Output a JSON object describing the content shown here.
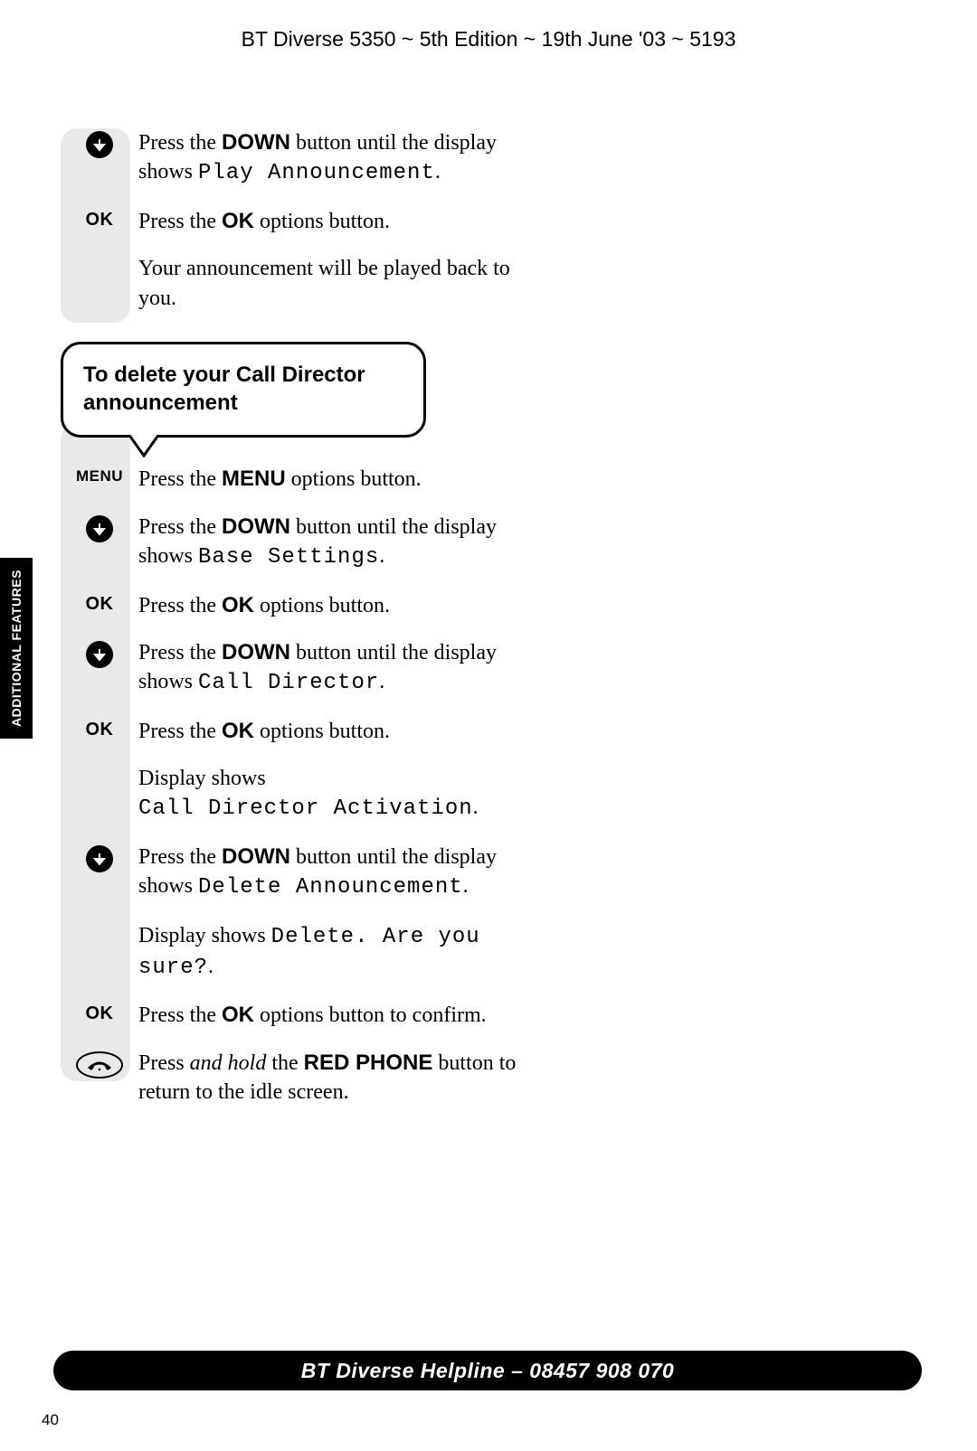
{
  "header": "BT Diverse 5350 ~ 5th Edition ~ 19th June '03 ~ 5193",
  "side_tab": "ADDITIONAL FEATURES",
  "section1": {
    "steps": [
      {
        "key_type": "down",
        "text_pre": "Press the ",
        "bold1": "DOWN",
        "text_mid": " button until the display shows ",
        "lcd1": "Play Announcement",
        "text_post": "."
      },
      {
        "key_type": "ok",
        "key_label": "OK",
        "text_pre": "Press the ",
        "bold1": "OK",
        "text_post": " options button."
      },
      {
        "key_type": "blank",
        "text_plain": "Your announcement will be played back to you."
      }
    ]
  },
  "callout": "To delete your Call Director announcement",
  "section2": {
    "steps": [
      {
        "key_type": "menu",
        "key_label": "MENU",
        "text_pre": "Press the ",
        "bold1": "MENU",
        "text_post": " options button."
      },
      {
        "key_type": "down",
        "text_pre": "Press the ",
        "bold1": "DOWN",
        "text_mid": " button until the display shows ",
        "lcd1": "Base Settings",
        "text_post": "."
      },
      {
        "key_type": "ok",
        "key_label": "OK",
        "text_pre": "Press the ",
        "bold1": "OK",
        "text_post": " options button."
      },
      {
        "key_type": "down",
        "text_pre": "Press the ",
        "bold1": "DOWN",
        "text_mid": " button until the display shows ",
        "lcd1": "Call Director",
        "text_post": "."
      },
      {
        "key_type": "ok",
        "key_label": "OK",
        "text_pre": "Press the ",
        "bold1": "OK",
        "text_post": " options button."
      },
      {
        "key_type": "blank",
        "text_plain_pre": "Display shows",
        "lcd_below": "Call Director Activation",
        "text_post": "."
      },
      {
        "key_type": "down",
        "text_pre": "Press the ",
        "bold1": "DOWN",
        "text_mid": " button until the display shows ",
        "lcd1": "Delete Announcement",
        "text_post": "."
      },
      {
        "key_type": "blank",
        "text_plain_pre": "Display shows ",
        "lcd_inline": "Delete. Are you sure?",
        "text_post": "."
      },
      {
        "key_type": "ok",
        "key_label": "OK",
        "text_pre": "Press the ",
        "bold1": "OK",
        "text_post": " options button to confirm."
      },
      {
        "key_type": "phone",
        "text_pre": "Press ",
        "italic1": "and hold",
        "text_mid": " the ",
        "bold1": "RED PHONE",
        "text_post": " button to return to the idle screen."
      }
    ]
  },
  "helpline": "BT Diverse Helpline – 08457 908 070",
  "page_number": "40"
}
